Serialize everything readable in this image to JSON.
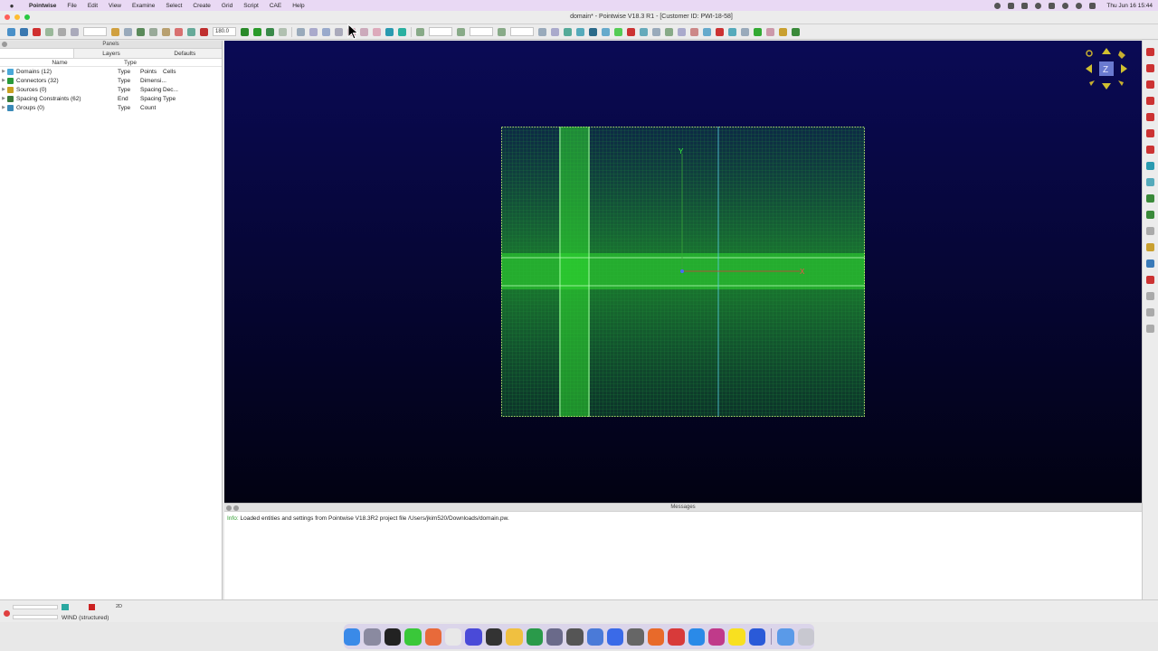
{
  "menubar": {
    "items": [
      "Pointwise",
      "File",
      "Edit",
      "View",
      "Examine",
      "Select",
      "Create",
      "Grid",
      "Script",
      "CAE",
      "Help"
    ],
    "clock": "Thu Jun 16  15:44"
  },
  "window": {
    "title": "domain* - Pointwise V18.3 R1 - [Customer ID: PWI-18-58]"
  },
  "toolbar": {
    "angle_value": "180.0"
  },
  "panels": {
    "title": "Panels",
    "tabs": [
      "",
      "Layers",
      "Defaults"
    ],
    "columns": {
      "name": "Name",
      "type": "Type"
    },
    "rows": [
      {
        "name": "Domains (12)",
        "cols": [
          "Type",
          "Points",
          "Cells"
        ],
        "icon_color": "#4aa8d8"
      },
      {
        "name": "Connectors (32)",
        "cols": [
          "Type",
          "Dimensi...",
          ""
        ],
        "icon_color": "#2a9a3a"
      },
      {
        "name": "Sources (0)",
        "cols": [
          "Type",
          "Spacing",
          "Dec..."
        ],
        "icon_color": "#c8a020"
      },
      {
        "name": "Spacing Constraints (62)",
        "cols": [
          "End",
          "Spacing",
          "Type"
        ],
        "icon_color": "#3a7a3a"
      },
      {
        "name": "Groups (0)",
        "cols": [
          "Type",
          "Count",
          ""
        ],
        "icon_color": "#3a8ab8"
      }
    ]
  },
  "viewport": {
    "axis_y": "Y",
    "axis_x": "X",
    "nav_label": "Z"
  },
  "messages": {
    "title": "Messages",
    "lines": [
      {
        "level": "Info:",
        "text": "Loaded entities and settings from Pointwise V18.3R2 project file /Users/jkim520/Downloads/domain.pw."
      }
    ]
  },
  "status": {
    "mode": "2D",
    "solver": "WIND (structured)"
  },
  "colors": {
    "viewport_top": "#0a0a55",
    "mesh_green": "#33dd33",
    "info_green": "#2a9a2a"
  }
}
